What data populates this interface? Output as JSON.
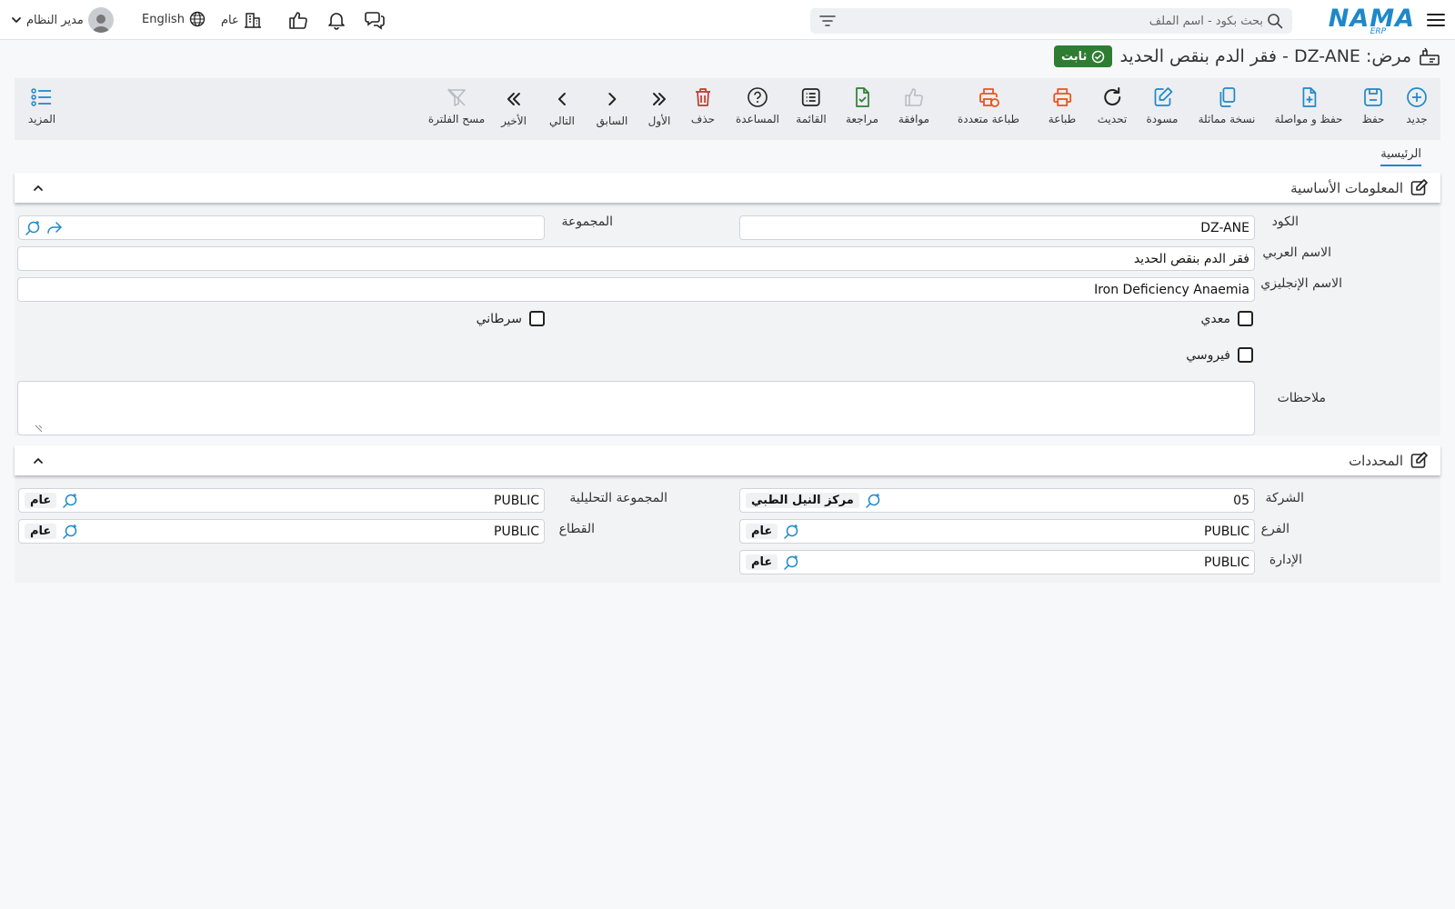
{
  "app": {
    "logo_text": "NAMA",
    "logo_sub": "ERP"
  },
  "search": {
    "placeholder": "بحث بكود - اسم الملف"
  },
  "header": {
    "user_name": "مدير النظام",
    "language": "English",
    "company_scope": "عام"
  },
  "page": {
    "title": "مرض: DZ-ANE - فقر الدم بنقص الحديد",
    "status_badge": "ثابت"
  },
  "toolbar": {
    "new": "جديد",
    "save": "حفظ",
    "save_continue": "حفظ و مواصلة",
    "duplicate": "نسخة مماثلة",
    "draft": "مسودة",
    "refresh": "تحديث",
    "print": "طباعة",
    "multi_print": "طباعة متعددة",
    "approve": "موافقة",
    "review": "مراجعة",
    "list": "القائمة",
    "help": "المساعدة",
    "delete": "حذف",
    "first": "الأول",
    "previous": "السابق",
    "next": "التالي",
    "last": "الأخير",
    "clear_filter": "مسح الفلترة",
    "more": "المزيد"
  },
  "tabs": {
    "main": "الرئيسية"
  },
  "basic_info": {
    "title": "المعلومات الأساسية",
    "code_label": "الكود",
    "code_value": "DZ-ANE",
    "group_label": "المجموعة",
    "group_value": "",
    "arabic_name_label": "الاسم العربي",
    "arabic_name_value": "فقر الدم بنقص الحديد",
    "english_name_label": "الاسم الإنجليزي",
    "english_name_value": "Iron Deficiency Anaemia",
    "infectious_label": "معدي",
    "infectious_checked": false,
    "cancerous_label": "سرطاني",
    "cancerous_checked": false,
    "viral_label": "فيروسي",
    "viral_checked": false,
    "notes_label": "ملاحظات",
    "notes_value": ""
  },
  "dimensions": {
    "title": "المحددات",
    "company_label": "الشركة",
    "company_code": "05",
    "company_name": "مركز النيل الطبي",
    "analytic_group_label": "المجموعة التحليلية",
    "analytic_group_code": "PUBLIC",
    "analytic_group_name": "عام",
    "branch_label": "الفرع",
    "branch_code": "PUBLIC",
    "branch_name": "عام",
    "sector_label": "القطاع",
    "sector_code": "PUBLIC",
    "sector_name": "عام",
    "department_label": "الإدارة",
    "department_code": "PUBLIC",
    "department_name": "عام"
  },
  "colors": {
    "accent": "#1e88c9",
    "status_ok": "#2e7d32",
    "print_orange": "#e8561c",
    "delete_red": "#c0392b",
    "review_green": "#2e7d32"
  }
}
